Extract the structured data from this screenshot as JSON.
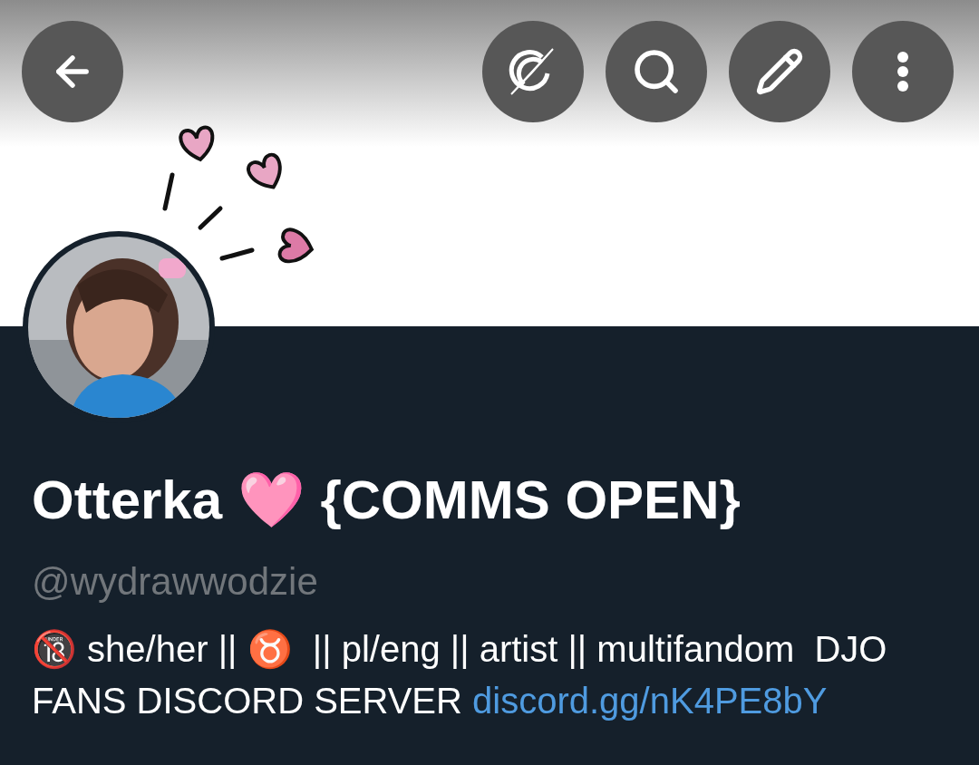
{
  "profile": {
    "name": "Otterka 🩷 {COMMS OPEN}",
    "handle": "@wydrawwodzie",
    "bio": {
      "text": "🔞 she/her || ♉  || pl/eng || artist || multifandom  DJO FANS DISCORD SERVER ",
      "link": "discord.gg/nK4PE8bY"
    }
  }
}
